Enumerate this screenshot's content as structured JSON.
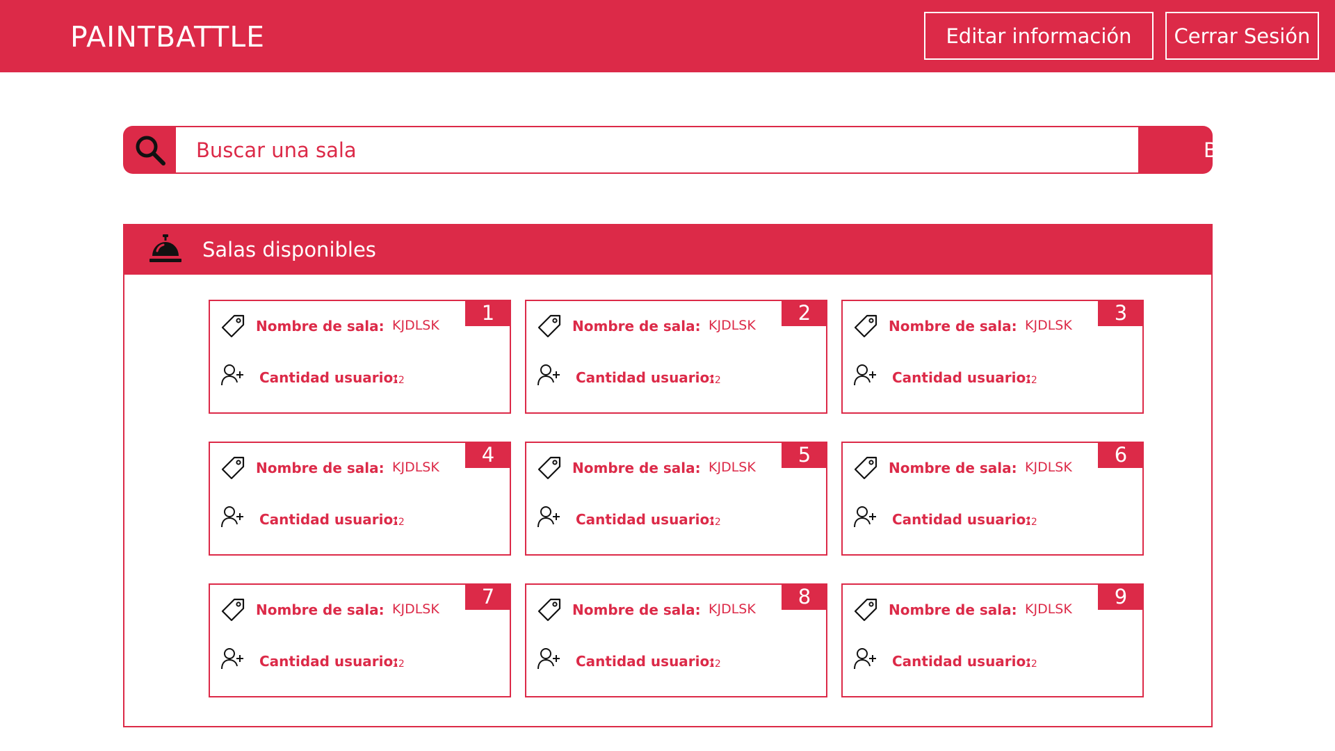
{
  "header": {
    "brand": "PAINTBATTLE",
    "edit_label": "Editar información",
    "logout_label": "Cerrar Sesión"
  },
  "search": {
    "placeholder": "Buscar una sala",
    "button_label": "Buscar"
  },
  "rooms_panel": {
    "title": "Salas disponibles",
    "rooms": [
      {
        "number": "1",
        "name_label": "Nombre de sala:",
        "name_value": "KJDLSK",
        "users_label": "Cantidad usuario:",
        "users_value": "12"
      },
      {
        "number": "2",
        "name_label": "Nombre de sala:",
        "name_value": "KJDLSK",
        "users_label": "Cantidad usuario:",
        "users_value": "12"
      },
      {
        "number": "3",
        "name_label": "Nombre de sala:",
        "name_value": "KJDLSK",
        "users_label": "Cantidad usuario:",
        "users_value": "12"
      },
      {
        "number": "4",
        "name_label": "Nombre de sala:",
        "name_value": "KJDLSK",
        "users_label": "Cantidad usuario:",
        "users_value": "12"
      },
      {
        "number": "5",
        "name_label": "Nombre de sala:",
        "name_value": "KJDLSK",
        "users_label": "Cantidad usuario:",
        "users_value": "12"
      },
      {
        "number": "6",
        "name_label": "Nombre de sala:",
        "name_value": "KJDLSK",
        "users_label": "Cantidad usuario:",
        "users_value": "12"
      },
      {
        "number": "7",
        "name_label": "Nombre de sala:",
        "name_value": "KJDLSK",
        "users_label": "Cantidad usuario:",
        "users_value": "12"
      },
      {
        "number": "8",
        "name_label": "Nombre de sala:",
        "name_value": "KJDLSK",
        "users_label": "Cantidad usuario:",
        "users_value": "12"
      },
      {
        "number": "9",
        "name_label": "Nombre de sala:",
        "name_value": "KJDLSK",
        "users_label": "Cantidad usuario:",
        "users_value": "12"
      }
    ]
  },
  "icons": {
    "search": "search-icon",
    "panel": "bell-icon",
    "room_name": "tag-icon",
    "room_users": "add-user-icon"
  },
  "colors": {
    "accent": "#dc2a48",
    "background": "#ffffff",
    "on_accent": "#ffffff",
    "icon": "#111111"
  }
}
